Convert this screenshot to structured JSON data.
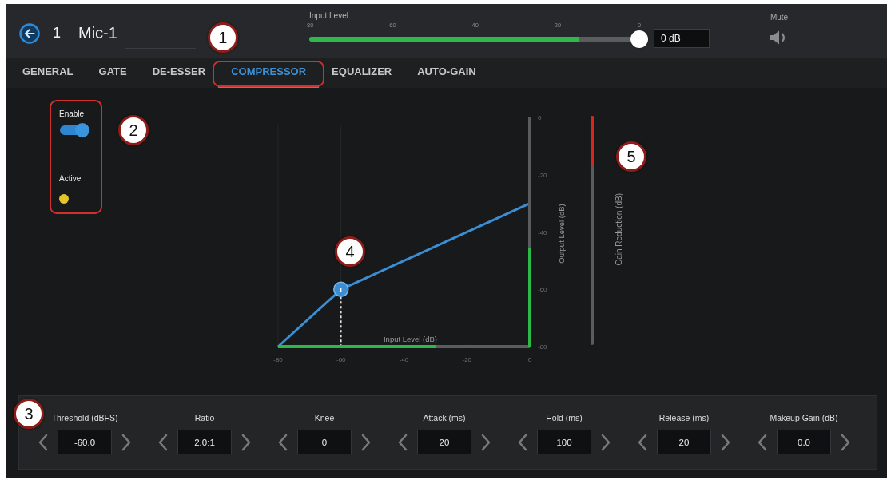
{
  "header": {
    "channel_number": "1",
    "channel_name": "Mic-1",
    "callout": "1",
    "input_level": {
      "label": "Input Level",
      "ticks": [
        "-80",
        "-60",
        "-40",
        "-20",
        "0"
      ],
      "level": 0.84,
      "thumb": {
        "level": 1
      },
      "value": "0 dB"
    },
    "mute": {
      "label": "Mute"
    }
  },
  "tabs": [
    {
      "label": "GENERAL",
      "selected": false,
      "highlighted": false
    },
    {
      "label": "GATE",
      "selected": false,
      "highlighted": false
    },
    {
      "label": "DE-ESSER",
      "selected": false,
      "highlighted": false
    },
    {
      "label": "COMPRESSOR",
      "selected": true,
      "highlighted": true
    },
    {
      "label": "EQUALIZER",
      "selected": false,
      "highlighted": false
    },
    {
      "label": "AUTO-GAIN",
      "selected": false,
      "highlighted": false
    }
  ],
  "status_panel": {
    "highlighted": true,
    "callout": "2",
    "enable": {
      "label": "Enable",
      "on": true
    },
    "active": {
      "label": "Active",
      "on": true
    }
  },
  "transfer_graph": {
    "callout": "4",
    "threshold_marker": {
      "label": "T"
    },
    "input_meter": {
      "level": 0.63
    },
    "output_meter": {
      "level": 0.43
    },
    "chart_data": {
      "type": "line",
      "xlabel": "Input Level (dB)",
      "ylabel": "Output Level (dB)",
      "x": [
        -80,
        -60,
        0
      ],
      "values": [
        -80,
        -60,
        -30
      ],
      "color": "#3b8ed3",
      "xlim": [
        -80,
        0
      ],
      "ylim": [
        -80,
        0
      ],
      "xticks": [
        -80,
        -60,
        -40,
        -20,
        0
      ],
      "yticks": [
        0,
        -20,
        -40,
        -60,
        -80
      ],
      "grid": "x"
    }
  },
  "gain_reduction": {
    "label": "Gain Reduction (dB)",
    "level": 0.22,
    "callout": "5"
  },
  "parameters": {
    "callout": "3",
    "items": [
      {
        "label": "Threshold (dBFS)",
        "value": "-60.0"
      },
      {
        "label": "Ratio",
        "value": "2.0:1"
      },
      {
        "label": "Knee",
        "value": "0"
      },
      {
        "label": "Attack (ms)",
        "value": "20"
      },
      {
        "label": "Hold (ms)",
        "value": "100"
      },
      {
        "label": "Release (ms)",
        "value": "20"
      },
      {
        "label": "Makeup Gain (dB)",
        "value": "0.0"
      }
    ]
  }
}
